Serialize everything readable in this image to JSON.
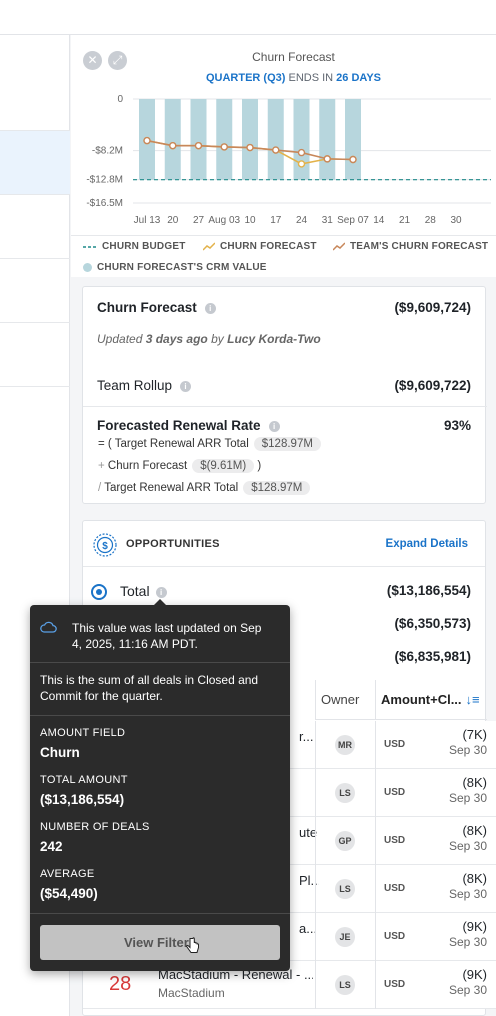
{
  "chart_data": {
    "type": "bar",
    "title": "Churn Forecast",
    "subtitle": {
      "quarter": "QUARTER (Q3)",
      "ends": "ENDS IN",
      "days": "26 DAYS"
    },
    "y_ticks": [
      "0",
      "-$8.2M",
      "-$12.8M",
      "-$16.5M"
    ],
    "y_tick_values": [
      0,
      -8.2,
      -12.8,
      -16.5
    ],
    "ylim": [
      -16.5,
      0
    ],
    "x_ticks": [
      "Jul 13",
      "20",
      "27",
      "Aug 03",
      "10",
      "17",
      "24",
      "31",
      "Sep 07",
      "14",
      "21",
      "28",
      "30"
    ],
    "categories": [
      "Jul 13",
      "Jul 20",
      "Jul 27",
      "Aug 03",
      "Aug 10",
      "Aug 17",
      "Aug 24",
      "Aug 31",
      "Sep 07"
    ],
    "series": [
      {
        "name": "CHURN FORECAST'S CRM VALUE",
        "type": "bar",
        "color": "#b7d6dd",
        "values": [
          -12.8,
          -12.8,
          -12.8,
          -12.8,
          -12.8,
          -12.8,
          -12.8,
          -12.8,
          -12.8
        ]
      },
      {
        "name": "CHURN FORECAST",
        "type": "line",
        "color": "#e3b24a",
        "values": [
          -6.6,
          -7.4,
          -7.4,
          -7.6,
          -7.7,
          -8.1,
          -10.3,
          -9.5,
          -9.6
        ]
      },
      {
        "name": "TEAM'S CHURN FORECAST",
        "type": "line",
        "color": "#c8875a",
        "values": [
          -6.6,
          -7.4,
          -7.4,
          -7.6,
          -7.7,
          -8.1,
          -8.5,
          -9.5,
          -9.6
        ]
      },
      {
        "name": "CHURN BUDGET",
        "type": "dashed",
        "color": "#1f8a8a",
        "values": [
          -12.8
        ]
      }
    ],
    "grid": true,
    "legend": "bottom"
  },
  "legend": {
    "budget": "CHURN BUDGET",
    "forecast": "CHURN FORECAST",
    "team": "TEAM'S CHURN FORECAST",
    "crm": "CHURN FORECAST'S CRM VALUE"
  },
  "summary": {
    "churn_forecast_label": "Churn Forecast",
    "churn_forecast_value": "($9,609,724)",
    "updated_prefix": "Updated",
    "updated_ago": "3 days ago",
    "updated_by": "by",
    "updated_user": "Lucy Korda-Two",
    "team_rollup_label": "Team Rollup",
    "team_rollup_value": "($9,609,722)",
    "renewal_label": "Forecasted Renewal Rate",
    "renewal_value": "93%",
    "formula": {
      "l1_prefix": "= ( Target Renewal ARR Total",
      "l1_pill": "$128.97M",
      "l2_op": "+",
      "l2_label": "Churn Forecast",
      "l2_pill": "$(9.61M)",
      "l2_suffix": ")",
      "l3_op": "/",
      "l3_label": "Target Renewal ARR Total",
      "l3_pill": "$128.97M"
    }
  },
  "opportunities": {
    "title": "OPPORTUNITIES",
    "expand": "Expand Details",
    "total_label": "Total",
    "total_value": "($13,186,554)",
    "row2_value": "($6,350,573)",
    "row3_value": "($6,835,981)"
  },
  "table": {
    "headers": {
      "owner": "Owner",
      "amount": "Amount+Cl..."
    },
    "rows": [
      {
        "name": "r...",
        "owner": "MR",
        "currency": "USD",
        "amount": "(7K)",
        "date": "Sep 30"
      },
      {
        "name": "",
        "owner": "LS",
        "currency": "USD",
        "amount": "(8K)",
        "date": "Sep 30"
      },
      {
        "name": "ute",
        "owner": "GP",
        "currency": "USD",
        "amount": "(8K)",
        "date": "Sep 30"
      },
      {
        "name": "Pl...",
        "owner": "LS",
        "currency": "USD",
        "amount": "(8K)",
        "date": "Sep 30"
      },
      {
        "name": "a...",
        "owner": "JE",
        "currency": "USD",
        "amount": "(9K)",
        "date": "Sep 30"
      },
      {
        "day": "28",
        "name": "MacStadium - Renewal - ...",
        "account": "MacStadium",
        "owner": "LS",
        "currency": "USD",
        "amount": "(9K)",
        "date": "Sep 30"
      }
    ]
  },
  "tooltip": {
    "updated": "This value was last updated on Sep 4, 2025, 11:16 AM PDT.",
    "desc": "This is the sum of all deals in Closed and Commit for the quarter.",
    "amount_field_label": "AMOUNT FIELD",
    "amount_field_value": "Churn",
    "total_amount_label": "TOTAL AMOUNT",
    "total_amount_value": "($13,186,554)",
    "num_deals_label": "NUMBER OF DEALS",
    "num_deals_value": "242",
    "average_label": "AVERAGE",
    "average_value": "($54,490)",
    "button": "View Filters"
  }
}
